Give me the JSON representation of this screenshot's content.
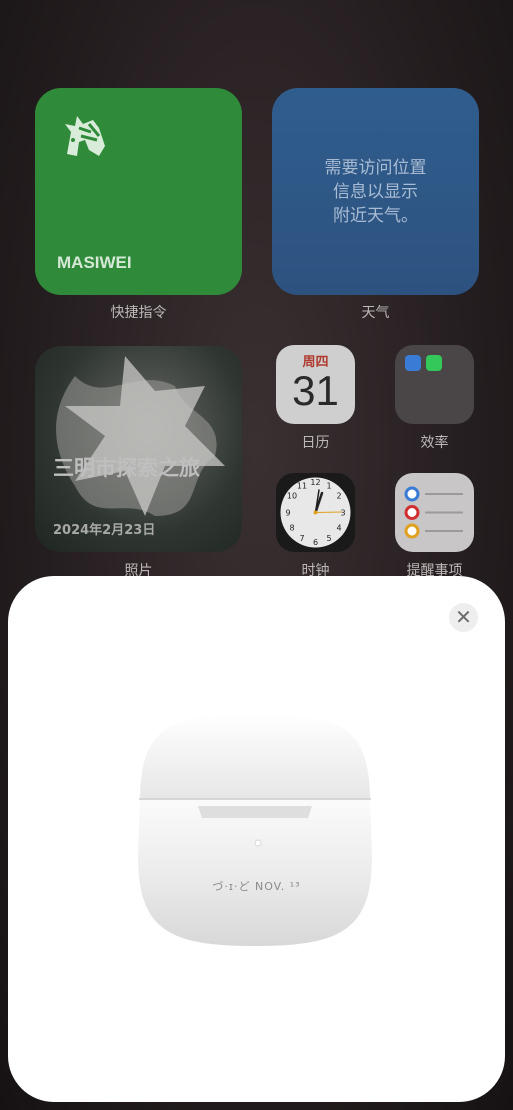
{
  "widgets": {
    "shortcuts": {
      "title": "MASIWEI",
      "label": "快捷指令"
    },
    "weather": {
      "message_lines": [
        "需要访问位置",
        "信息以显示",
        "附近天气。"
      ],
      "label": "天气"
    },
    "photos": {
      "title": "三明市探索之旅",
      "date": "2024年2月23日",
      "label": "照片"
    }
  },
  "apps": {
    "calendar": {
      "weekday": "周四",
      "date": "31",
      "label": "日历"
    },
    "efficiency": {
      "label": "效率"
    },
    "clock": {
      "label": "时钟"
    },
    "reminders": {
      "label": "提醒事项"
    }
  },
  "sheet": {
    "close_icon": "close-icon",
    "engraving": "づ·ɪ·ど NOV. ¹³"
  },
  "colors": {
    "shortcuts_green": "#2f8b3a",
    "weather_blue": "#2d5280",
    "calendar_red": "#b03a2e",
    "sheet_bg": "#ffffff"
  }
}
